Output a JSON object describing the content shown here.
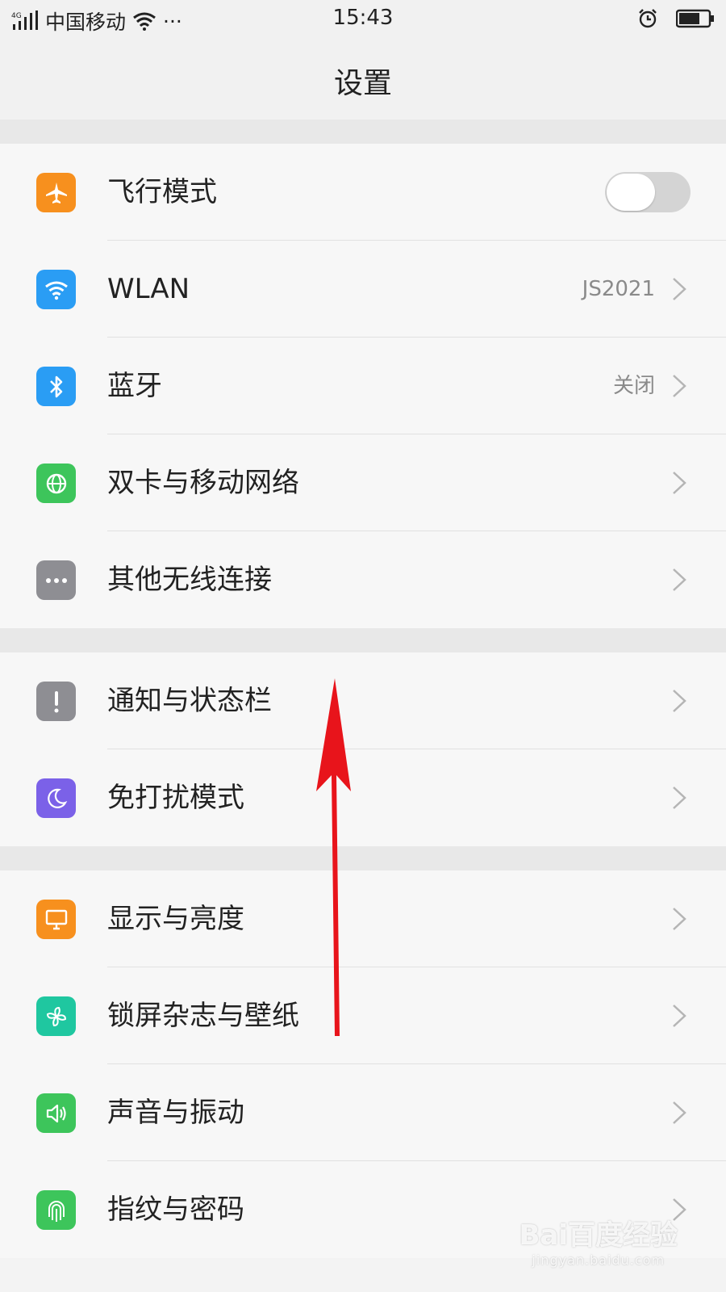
{
  "status_bar": {
    "network_type": "4G",
    "carrier": "中国移动",
    "more": "···",
    "time": "15:43"
  },
  "header": {
    "title": "设置"
  },
  "groups": [
    {
      "items": [
        {
          "label": "飞行模式",
          "icon": "airplane-icon",
          "icon_color": "#F7901E",
          "control": "toggle",
          "toggle_on": false
        },
        {
          "label": "WLAN",
          "icon": "wifi-icon",
          "icon_color": "#2A9DF4",
          "value": "JS2021"
        },
        {
          "label": "蓝牙",
          "icon": "bluetooth-icon",
          "icon_color": "#2A9DF4",
          "value": "关闭"
        },
        {
          "label": "双卡与移动网络",
          "icon": "globe-icon",
          "icon_color": "#3DC55B"
        },
        {
          "label": "其他无线连接",
          "icon": "more-dots-icon",
          "icon_color": "#8E8E93"
        }
      ]
    },
    {
      "items": [
        {
          "label": "通知与状态栏",
          "icon": "exclamation-icon",
          "icon_color": "#8E8E93"
        },
        {
          "label": "免打扰模式",
          "icon": "moon-icon",
          "icon_color": "#7B61E8"
        }
      ]
    },
    {
      "items": [
        {
          "label": "显示与亮度",
          "icon": "monitor-icon",
          "icon_color": "#F7901E"
        },
        {
          "label": "锁屏杂志与壁纸",
          "icon": "pinwheel-icon",
          "icon_color": "#1FC7A0"
        },
        {
          "label": "声音与振动",
          "icon": "speaker-icon",
          "icon_color": "#3DC55B"
        },
        {
          "label": "指纹与密码",
          "icon": "fingerprint-icon",
          "icon_color": "#3DC55B"
        }
      ]
    }
  ],
  "annotation": {
    "arrow_color": "#E8141B",
    "direction": "up"
  },
  "watermark": {
    "main": "Bai百度经验",
    "sub": "jingyan.baidu.com"
  }
}
